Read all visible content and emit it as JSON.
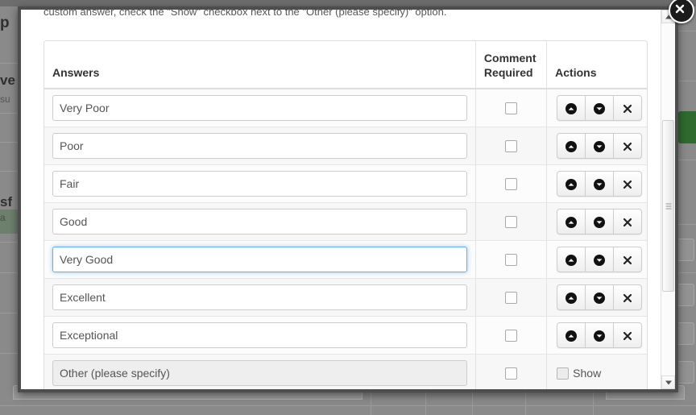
{
  "modal": {
    "intro_text": "custom answer, check the \"Show\" checkbox next to the \"Other (please specify)\" option.",
    "close_label": "×",
    "close_icon": "close-icon"
  },
  "table": {
    "headers": {
      "answers": "Answers",
      "comment_required_line1": "Comment",
      "comment_required_line2": "Required",
      "actions": "Actions"
    },
    "actions": {
      "move_up_icon": "circle-up-arrow-icon",
      "move_down_icon": "circle-down-arrow-icon",
      "remove_icon": "remove-x-icon"
    },
    "show_label": "Show",
    "rows": [
      {
        "answer": "Very Poor",
        "comment_required": false,
        "focused": false,
        "disabled": false,
        "has_actions": true
      },
      {
        "answer": "Poor",
        "comment_required": false,
        "focused": false,
        "disabled": false,
        "has_actions": true
      },
      {
        "answer": "Fair",
        "comment_required": false,
        "focused": false,
        "disabled": false,
        "has_actions": true
      },
      {
        "answer": "Good",
        "comment_required": false,
        "focused": false,
        "disabled": false,
        "has_actions": true
      },
      {
        "answer": "Very Good",
        "comment_required": false,
        "focused": true,
        "disabled": false,
        "has_actions": true
      },
      {
        "answer": "Excellent",
        "comment_required": false,
        "focused": false,
        "disabled": false,
        "has_actions": true
      },
      {
        "answer": "Exceptional",
        "comment_required": false,
        "focused": false,
        "disabled": false,
        "has_actions": true
      },
      {
        "answer": "Other (please specify)",
        "comment_required": false,
        "focused": false,
        "disabled": true,
        "has_actions": false
      }
    ]
  },
  "scrollbar": {
    "up_icon": "scroll-up-arrow-icon",
    "down_icon": "scroll-down-arrow-icon"
  },
  "background": {
    "fragment_1": "p",
    "fragment_2": "ve",
    "fragment_3": "su",
    "fragment_4": "sf",
    "fragment_5": "a"
  },
  "colors": {
    "focus_border": "#66afe9",
    "modal_border": "#4d4d4d",
    "accent_green": "#2f6b2f",
    "text": "#555555"
  }
}
